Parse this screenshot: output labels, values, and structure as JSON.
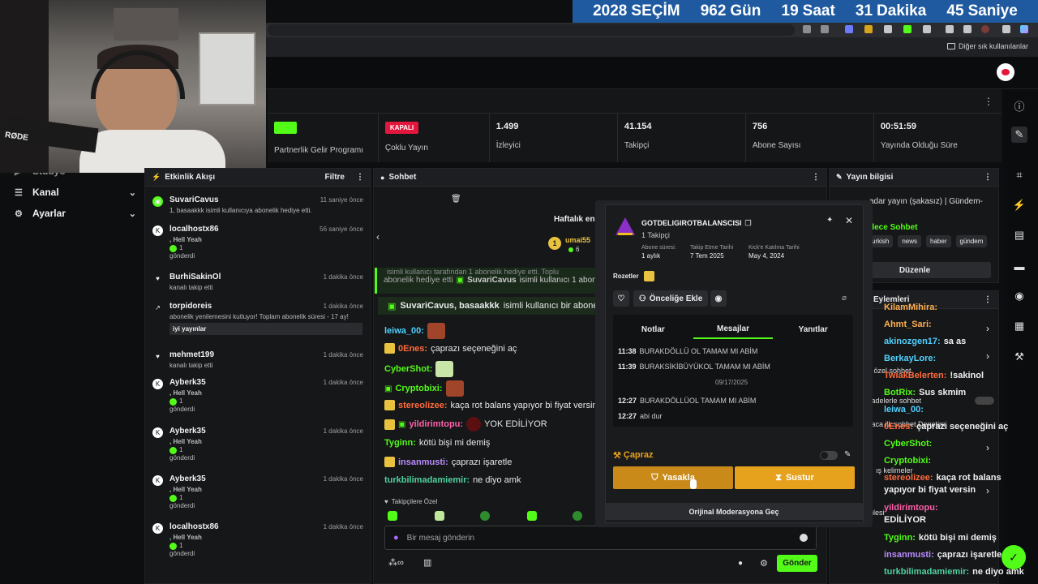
{
  "countdown": {
    "year": "2028",
    "label": "SEÇİM",
    "days": "962",
    "days_unit": "Gün",
    "hours": "19",
    "hours_unit": "Saat",
    "minutes": "31",
    "minutes_unit": "Dakika",
    "seconds": "45",
    "seconds_unit": "Saniye"
  },
  "browser": {
    "bookmarks_label": "Diğer sık kullanılanlar"
  },
  "webcam": {
    "mic_brand": "RØDE"
  },
  "stats": [
    {
      "value": "",
      "label": "Partnerlik Gelir Programı",
      "badge": "",
      "badge_color": "#53fc18"
    },
    {
      "value": "",
      "label": "Çoklu Yayın",
      "badge": "KAPALI",
      "badge_color": "#e3173d"
    },
    {
      "value": "1.499",
      "label": "İzleyici",
      "badge": ""
    },
    {
      "value": "41.154",
      "label": "Takipçi",
      "badge": ""
    },
    {
      "value": "756",
      "label": "Abone Sayısı",
      "badge": ""
    },
    {
      "value": "00:51:59",
      "label": "Yayında Olduğu Süre",
      "badge": ""
    }
  ],
  "sidebar": {
    "items": [
      {
        "label": "Stüdyo",
        "icon": "studio-icon"
      },
      {
        "label": "Kanal",
        "icon": "channel-icon"
      },
      {
        "label": "Ayarlar",
        "icon": "gear-icon"
      }
    ]
  },
  "activity": {
    "title": "Etkinlik Akışı",
    "filter": "Filtre",
    "items": [
      {
        "user": "SuvariCavus",
        "time": "11 saniye önce",
        "lines": [
          "1, basaakkk isimli kullanıcıya abonelik hediye etti."
        ],
        "type": "gift"
      },
      {
        "user": "localhostx86",
        "time": "56 saniye önce",
        "lines": [
          ", Hell Yeah",
          "1",
          "gönderdi"
        ],
        "type": "kick"
      },
      {
        "user": "BurhiSakinOl",
        "time": "1 dakika önce",
        "lines": [
          "kanalı takip etti"
        ],
        "type": "follow"
      },
      {
        "user": "torpidoreis",
        "time": "1 dakika önce",
        "lines": [
          "abonelik yenilemesini kutluyor! Toplam abonelik süresi - 17 ay!",
          "iyi yayınlar"
        ],
        "type": "resub"
      },
      {
        "user": "mehmet199",
        "time": "1 dakika önce",
        "lines": [
          "kanalı takip etti"
        ],
        "type": "follow"
      },
      {
        "user": "Ayberk35",
        "time": "1 dakika önce",
        "lines": [
          ", Hell Yeah",
          "1",
          "gönderdi"
        ],
        "type": "kick"
      },
      {
        "user": "Ayberk35",
        "time": "1 dakika önce",
        "lines": [
          ", Hell Yeah",
          "1",
          "gönderdi"
        ],
        "type": "kick"
      },
      {
        "user": "Ayberk35",
        "time": "1 dakika önce",
        "lines": [
          ", Hell Yeah",
          "1",
          "gönderdi"
        ],
        "type": "kick"
      },
      {
        "user": "localhostx86",
        "time": "1 dakika önce",
        "lines": [
          ", Hell Yeah",
          "1",
          "gönderdi"
        ],
        "type": "kick"
      }
    ]
  },
  "chat": {
    "title": "Sohbet",
    "weekly": "Haftalık en",
    "weekly_user": "umai55",
    "weekly_count": "6",
    "gift_banner_old": "abonelik hediye etti",
    "gift_banner_user": "SuvariCavus",
    "gift_banner_text": "isimli kullanıcı 1 abone",
    "gift_banner_top": "isimli kullanıcı tarafından 1 abonelik hediye etti. Toplu",
    "gift_banner2_user": "SuvariCavus, basaakkk",
    "gift_banner2_text": "isimli kullanıcı bir abone",
    "messages": [
      {
        "user": "leiwa_00:",
        "text": "",
        "color": "#4fd1ff"
      },
      {
        "user": "0Enes:",
        "text": "çaprazı seçeneğini aç",
        "color": "#ff6a3d"
      },
      {
        "user": "CyberShot:",
        "text": "",
        "color": "#53fc18"
      },
      {
        "user": "Cryptobixi:",
        "text": "",
        "color": "#53fc18"
      },
      {
        "user": "stereolizee:",
        "text": "kaça rot balans yapıyor bi fiyat versin",
        "color": "#ff6a3d"
      },
      {
        "user": "yildirimtopu:",
        "text": "YOK EDİLİYOR",
        "color": "#ff5fa8"
      },
      {
        "user": "Tyginn:",
        "text": "kötü bişi mi demiş",
        "color": "#53fc18"
      },
      {
        "user": "insanmusti:",
        "text": "çaprazı işaretle",
        "color": "#b98cff"
      },
      {
        "user": "turkbilimadamiemir:",
        "text": "ne diyo amk",
        "color": "#4fd1a0"
      }
    ],
    "followers_only": "Takipçilere Özel",
    "input_placeholder": "Bir mesaj gönderin",
    "send": "Gönder"
  },
  "usercard": {
    "username": "GOTDELIGIROTBALANSCISI",
    "followers": "1 Takipçi",
    "meta": [
      {
        "label": "Abone süresi:",
        "value": "1 aylık"
      },
      {
        "label": "Takip Etme Tarihi",
        "value": "7 Tem 2025"
      },
      {
        "label": "Kick'e Katılma Tarihi",
        "value": "May 4, 2024"
      }
    ],
    "badges_label": "Rozetler",
    "priority": "Önceliğe Ekle",
    "tabs": [
      "Notlar",
      "Mesajlar",
      "Yanıtlar"
    ],
    "messages": [
      {
        "time": "11:38",
        "text": "BURAKDÖLLÜ OL TAMAM MI ABİM"
      },
      {
        "time": "11:39",
        "text": "BURAKSİKİBÜYÜKOL TAMAM MI ABİM"
      },
      {
        "time": "",
        "text": "09/17/2025"
      },
      {
        "time": "12:27",
        "text": "BURAKDÖLLÜOL TAMAM MI ABİM"
      },
      {
        "time": "12:27",
        "text": "abi dur"
      }
    ],
    "capraz": "Çapraz",
    "ban": "Yasakla",
    "mute": "Sustur",
    "original_mod": "Orijinal Moderasyona Geç"
  },
  "streaminfo": {
    "title": "Yayın bilgisi",
    "stream_title": "adar yayın (şakasız) | Gündem-",
    "lang": "dece Sohbet",
    "tags": [
      "urkish",
      "news",
      "haber",
      "gündem"
    ],
    "edit": "Düzenle"
  },
  "actions": {
    "title": "Eylemleri",
    "items": [
      "e özel sohbet",
      "ifadelerle sohbet",
      "kaca ilk sohbet Denetimi",
      "ış kelimeler",
      "nlesi"
    ]
  },
  "rightchat": [
    {
      "user": "KilamMihira:",
      "text": "",
      "color": "#ffb04f"
    },
    {
      "user": "Ahmt_Sari:",
      "text": "",
      "color": "#ffb04f"
    },
    {
      "user": "akinozgen17:",
      "text": "sa as",
      "color": "#4fd1ff"
    },
    {
      "user": "BerkayLore:",
      "text": "",
      "color": "#4fd1ff"
    },
    {
      "user": "TwiakBelerten:",
      "text": "!sakinol",
      "color": "#ff6a3d"
    },
    {
      "user": "BotRix:",
      "text": "Sus skmim",
      "color": "#53fc18"
    },
    {
      "user": "leiwa_00:",
      "text": "",
      "color": "#4fd1ff"
    },
    {
      "user": "0Enes:",
      "text": "çaprazı seçeneğini aç",
      "color": "#ff6a3d"
    },
    {
      "user": "CyberShot:",
      "text": "",
      "color": "#53fc18"
    },
    {
      "user": "Cryptobixi:",
      "text": "",
      "color": "#53fc18"
    },
    {
      "user": "stereolizee:",
      "text": "kaça rot balans",
      "color": "#ff6a3d"
    },
    {
      "user": "",
      "text": "yapıyor bi fiyat versin",
      "color": "#ffffff"
    },
    {
      "user": "yildirimtopu:",
      "text": "",
      "color": "#ff5fa8"
    },
    {
      "user": "",
      "text": "EDİLİYOR",
      "color": "#ffffff"
    },
    {
      "user": "Tyginn:",
      "text": "kötü bişi mi demiş",
      "color": "#53fc18"
    },
    {
      "user": "insanmusti:",
      "text": "çaprazı işaretle",
      "color": "#b98cff"
    },
    {
      "user": "turkbilimadamiemir:",
      "text": "ne diyo amk",
      "color": "#4fd1a0"
    }
  ],
  "colors": {
    "kick_green": "#53fc18",
    "ban": "#c98a1a",
    "mute": "#e6a21c",
    "countdown_bg": "#1f5aa0"
  }
}
